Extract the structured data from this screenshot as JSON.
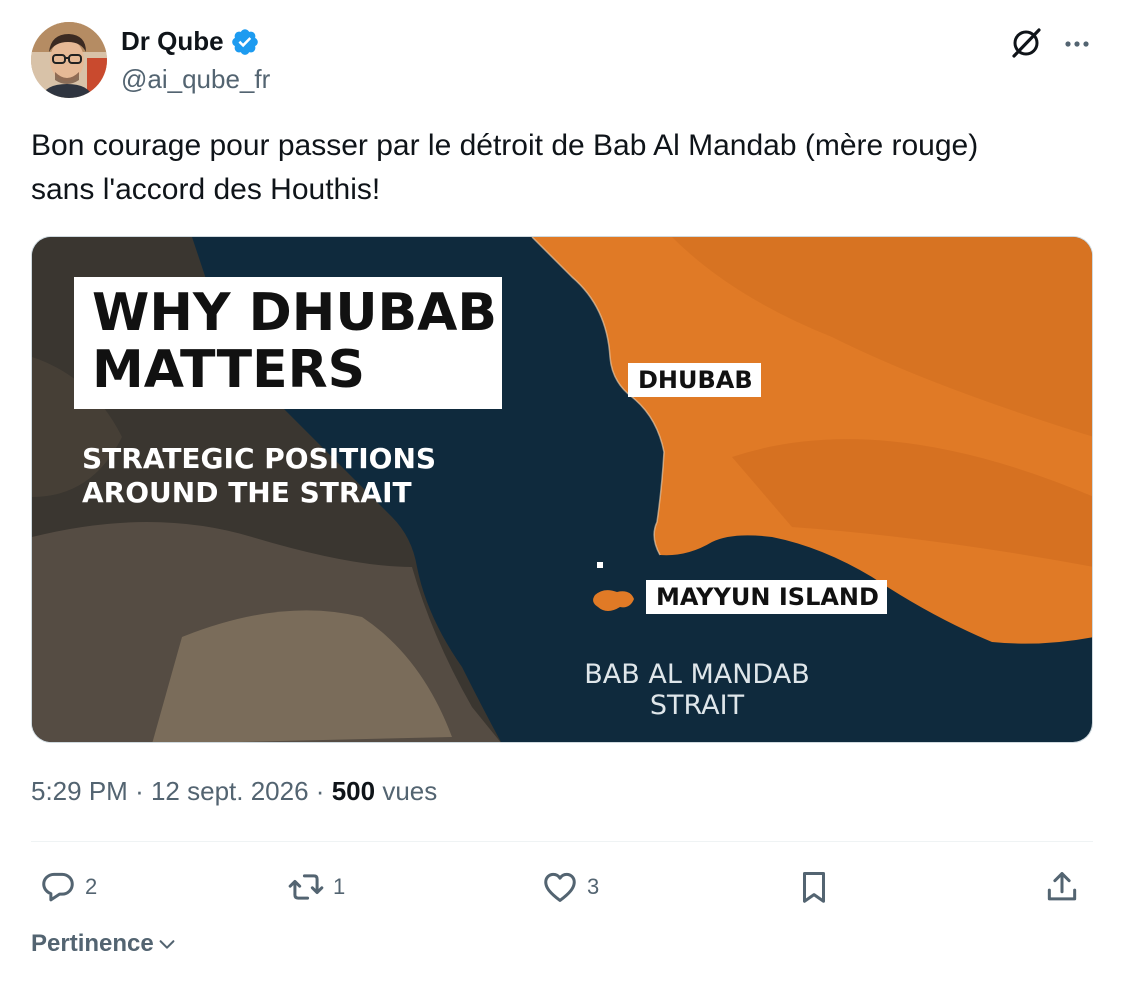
{
  "author": {
    "display_name": "Dr Qube",
    "handle": "@ai_qube_fr",
    "verified": true
  },
  "tweet": {
    "text_lines": [
      "Bon courage pour passer par le détroit de Bab Al Mandab (mère rouge)",
      "sans l'accord des Houthis!"
    ]
  },
  "media": {
    "title_lines": [
      "WHY DHUBAB",
      "MATTERS"
    ],
    "subtitle_lines": [
      "STRATEGIC POSITIONS",
      "AROUND THE STRAIT"
    ],
    "labels": {
      "dhubab": "DHUBAB",
      "mayyun": "MAYYUN ISLAND",
      "strait_lines": [
        "BAB AL MANDAB",
        "STRAIT"
      ]
    }
  },
  "meta": {
    "time": "5:29 PM",
    "separator": "·",
    "date": "12 sept. 2026",
    "views_count": "500",
    "views_label": "vues"
  },
  "actions": {
    "reply_count": "2",
    "retweet_count": "1",
    "like_count": "3"
  },
  "sort": {
    "label": "Pertinence"
  },
  "icons": {
    "verified": "verified-badge-icon",
    "grok": "grok-icon",
    "more": "more-icon",
    "reply": "reply-icon",
    "retweet": "retweet-icon",
    "like": "heart-icon",
    "bookmark": "bookmark-icon",
    "share": "share-icon",
    "sort": "chevron-down-icon"
  },
  "colors": {
    "accent": "#1d9bf0",
    "text": "#0f1419",
    "secondary": "#536471",
    "map_land": "#e07a26",
    "map_sea": "#0f2a3d"
  }
}
